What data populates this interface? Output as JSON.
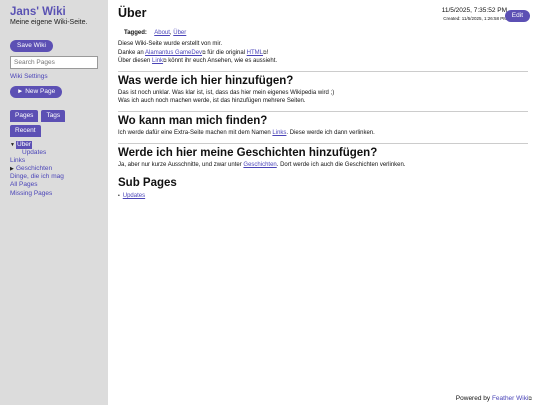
{
  "sidebar": {
    "title": "Jans' Wiki",
    "subtitle": "Meine eigene Wiki-Seite.",
    "save_label": "Save Wiki",
    "search_placeholder": "Search Pages",
    "settings_label": "Wiki Settings",
    "new_page_label": "► New Page",
    "tabs": [
      "Pages",
      "Tags",
      "Recent"
    ],
    "tree": {
      "uber": "Über",
      "updates": "Updates",
      "links": "Links",
      "geschichten": "Geschichten",
      "dinge": "Dinge, die ich mag",
      "all_pages": "All Pages",
      "missing": "Missing Pages",
      "expanded_arrow": "▼",
      "collapsed_arrow": "▶"
    }
  },
  "page": {
    "title": "Über",
    "date": "11/5/2025, 7:35:52 PM",
    "created": "Created: 11/5/2025, 1:26:58 PM",
    "edit_label": "Edit",
    "tagged_label": "Tagged:",
    "tags": [
      "About",
      "Über"
    ],
    "intro1": "Diese Wiki-Seite wurde erstellt von mir.",
    "intro2_pre": "Danke an ",
    "intro2_link": "Alamantus GameDev",
    "intro2_mid": " für die original ",
    "intro2_link2": "HTML",
    "intro2_post": "!",
    "intro3_pre": "Über diesen ",
    "intro3_link": "Link",
    "intro3_post": " könnt ihr euch Ansehen, wie es aussieht.",
    "h1": "Was werde ich hier hinzufügen?",
    "p1a": "Das ist noch unklar. Was klar ist, ist, dass das hier mein eigenes Wikipedia wird ;)",
    "p1b": "Was ich auch noch machen werde, ist das hinzufügen mehrere Seiten.",
    "h2": "Wo kann man mich finden?",
    "p2_pre": "Ich werde dafür eine Extra-Seite machen mit dem Namen ",
    "p2_link": "Links",
    "p2_post": ". Diese werde ich dann verlinken.",
    "h3": "Werde ich hier meine Geschichten hinzufügen?",
    "p3_pre": "Ja, aber nur kurze Ausschnitte, und zwar unter ",
    "p3_link": "Geschichten",
    "p3_post": ". Dort werde ich auch die Geschichten verlinken.",
    "h4": "Sub Pages",
    "subpages": [
      "Updates"
    ],
    "ext_icon": "⧉"
  },
  "footer": {
    "pre": "Powered by ",
    "link": "Feather Wiki"
  }
}
